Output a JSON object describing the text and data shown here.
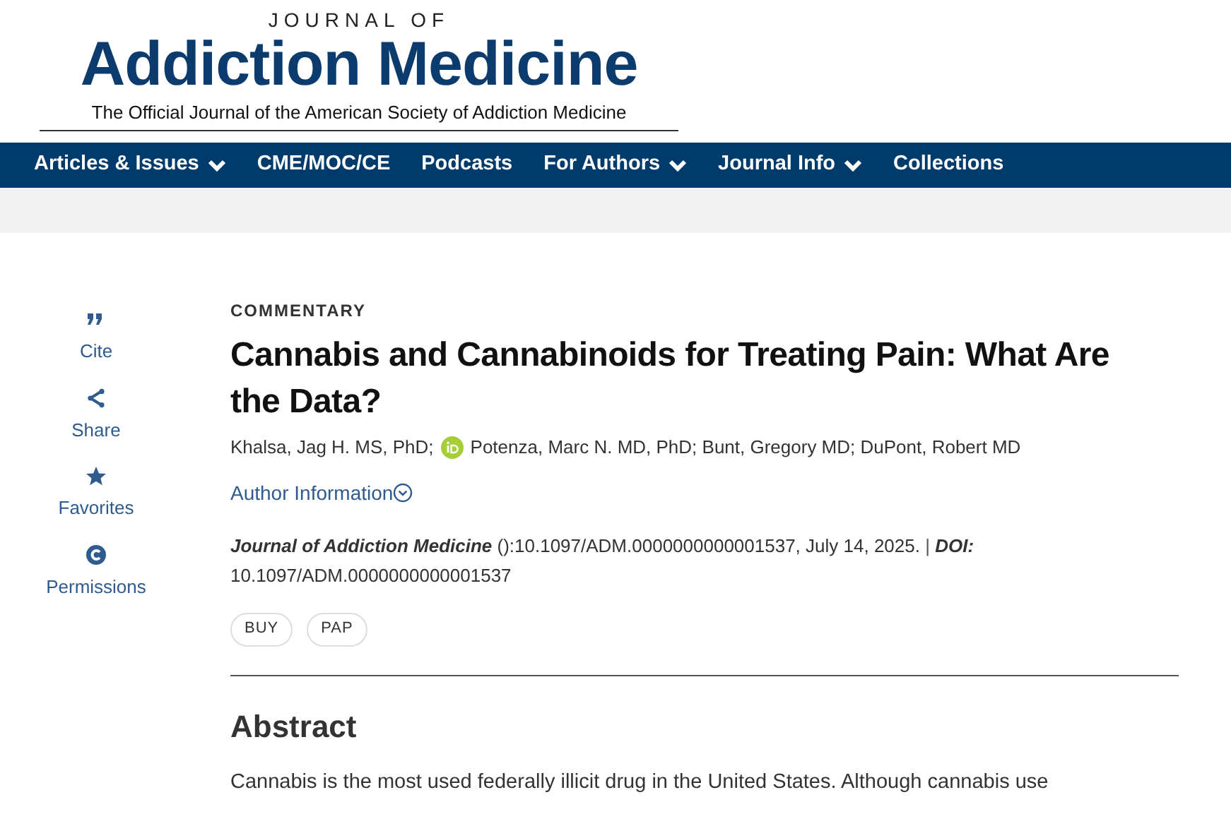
{
  "header": {
    "logo_top": "JOURNAL OF",
    "logo_main": "Addiction Medicine",
    "logo_tagline": "The Official Journal of the American Society of Addiction Medicine"
  },
  "nav": [
    {
      "label": "Articles & Issues",
      "has_menu": true
    },
    {
      "label": "CME/MOC/CE",
      "has_menu": false
    },
    {
      "label": "Podcasts",
      "has_menu": false
    },
    {
      "label": "For Authors",
      "has_menu": true
    },
    {
      "label": "Journal Info",
      "has_menu": true
    },
    {
      "label": "Collections",
      "has_menu": false
    }
  ],
  "sidebar": [
    {
      "kind": "cite",
      "label": "Cite"
    },
    {
      "kind": "share",
      "label": "Share"
    },
    {
      "kind": "favorite",
      "label": "Favorites"
    },
    {
      "kind": "permissions",
      "label": "Permissions"
    }
  ],
  "article": {
    "type": "COMMENTARY",
    "title": "Cannabis and Cannabinoids for Treating Pain: What Are the Data?",
    "authors": [
      {
        "name": "Khalsa, Jag H. MS, PhD;",
        "orcid": false
      },
      {
        "name": "Potenza, Marc N. MD, PhD; Bunt, Gregory MD; DuPont, Robert MD",
        "orcid": true
      }
    ],
    "author_information": "Author Information",
    "citation": {
      "journal": "Journal of Addiction Medicine",
      "details": "():10.1097/ADM.0000000000001537, July 14, 2025.",
      "separator": "|",
      "doi_label": "DOI:",
      "doi": "10.1097/ADM.0000000000001537"
    },
    "tags": [
      "BUY",
      "PAP"
    ],
    "abstract_heading": "Abstract",
    "abstract_text": "Cannabis is the most used federally illicit drug in the United States. Although cannabis use"
  }
}
